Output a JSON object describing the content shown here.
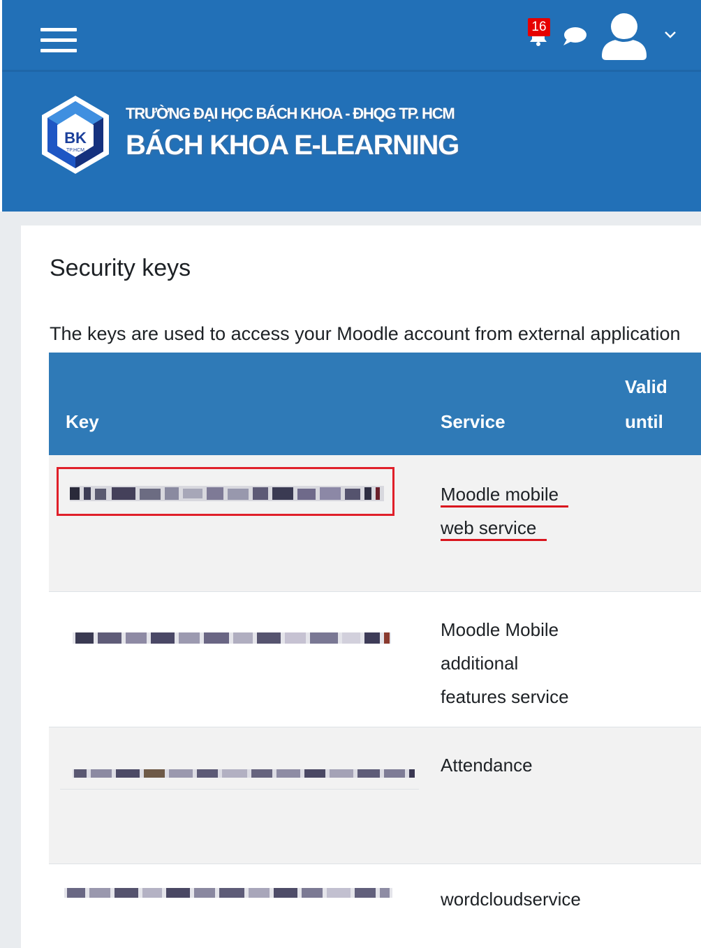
{
  "navbar": {
    "menu_icon": "hamburger-menu-icon",
    "notifications": {
      "icon": "bell-icon",
      "count": "16"
    },
    "messages_icon": "chat-bubble-icon",
    "user_icon": "user-avatar-icon",
    "user_menu_icon": "chevron-down-icon"
  },
  "banner": {
    "logo_text": "BK",
    "logo_subtext": "TP.HCM",
    "subtitle": "TRƯỜNG ĐẠI HỌC BÁCH KHOA - ĐHQG TP. HCM",
    "title": "BÁCH KHOA E-LEARNING"
  },
  "page": {
    "heading": "Security keys",
    "intro": "The keys are used to access your Moodle account from external application"
  },
  "table": {
    "headers": {
      "key": "Key",
      "service": "Service",
      "valid_line1": "Valid",
      "valid_line2": "until"
    },
    "rows": [
      {
        "service_lines": [
          "Moodle mobile",
          "web service"
        ],
        "key_state": "pixelated",
        "highlighted": true
      },
      {
        "service_lines": [
          "Moodle Mobile",
          "additional",
          "features service"
        ],
        "key_state": "pixelated"
      },
      {
        "service_lines": [
          "Attendance"
        ],
        "key_state": "pixelated"
      },
      {
        "service_lines": [
          "wordcloudservice"
        ],
        "key_state": "pixelated"
      }
    ]
  },
  "colors": {
    "brand_blue": "#2270b7",
    "table_header": "#2f7ab7",
    "highlight_red": "#e0202a",
    "badge_red": "#e60000"
  }
}
